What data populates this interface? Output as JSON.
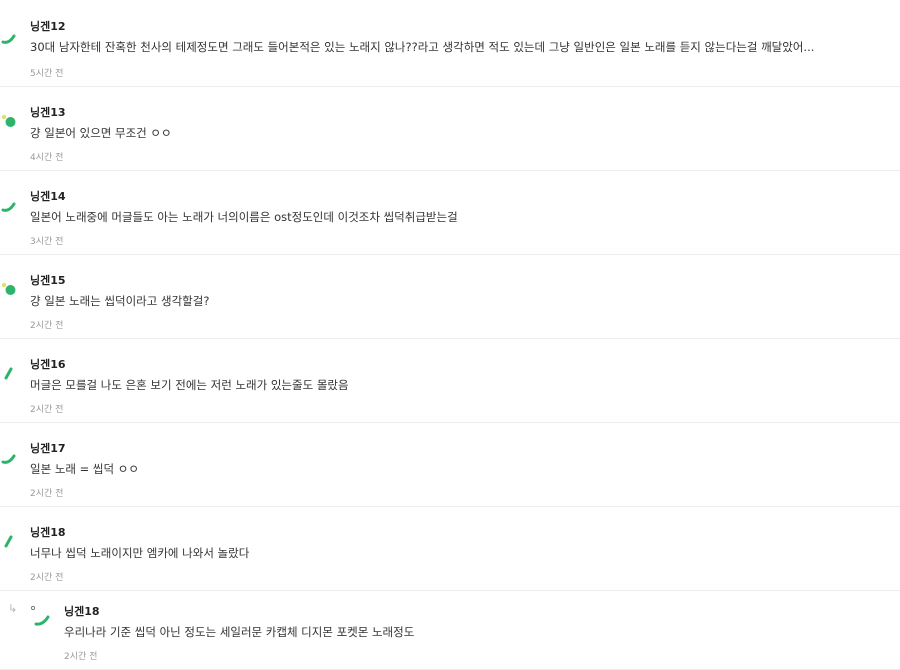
{
  "comments": [
    {
      "author": "닝겐12",
      "text": "30대 남자한테 잔혹한 천사의 테제정도면 그래도 들어본적은 있는 노래지 않나??라고 생각하면 적도 있는데 그냥 일반인은 일본 노래를 듣지 않는다는걸 깨달았어...",
      "time": "5시간 전",
      "avatar": "stroke"
    },
    {
      "author": "닝겐13",
      "text": "걍 일본어 있으면 무조건 ㅇㅇ",
      "time": "4시간 전",
      "avatar": "dot"
    },
    {
      "author": "닝겐14",
      "text": "일본어 노래중에 머글들도 아는 노래가 너의이름은 ost정도인데 이것조차 씹덕취급받는걸",
      "time": "3시간 전",
      "avatar": "stroke"
    },
    {
      "author": "닝겐15",
      "text": "걍 일본 노래는 씹덕이라고 생각할걸?",
      "time": "2시간 전",
      "avatar": "dot"
    },
    {
      "author": "닝겐16",
      "text": "머글은 모를걸 나도 은혼 보기 전에는 저런 노래가 있는줄도 몰랐음",
      "time": "2시간 전",
      "avatar": "slash"
    },
    {
      "author": "닝겐17",
      "text": "일본 노래 = 씹덕 ㅇㅇ",
      "time": "2시간 전",
      "avatar": "stroke"
    },
    {
      "author": "닝겐18",
      "text": "너무나 씹덕 노래이지만 엠카에 나와서 놀랐다",
      "time": "2시간 전",
      "avatar": "slash"
    },
    {
      "author": "닝겐18",
      "text": "우리나라 기준 씹덕 아닌 정도는 세일러문 카캡체 디지몬 포켓몬 노래정도",
      "time": "2시간 전",
      "avatar": "stroke",
      "reply_marker": "↳"
    }
  ],
  "colors": {
    "avatar_green": "#2db36b",
    "avatar_yellow": "#d7e66a"
  }
}
